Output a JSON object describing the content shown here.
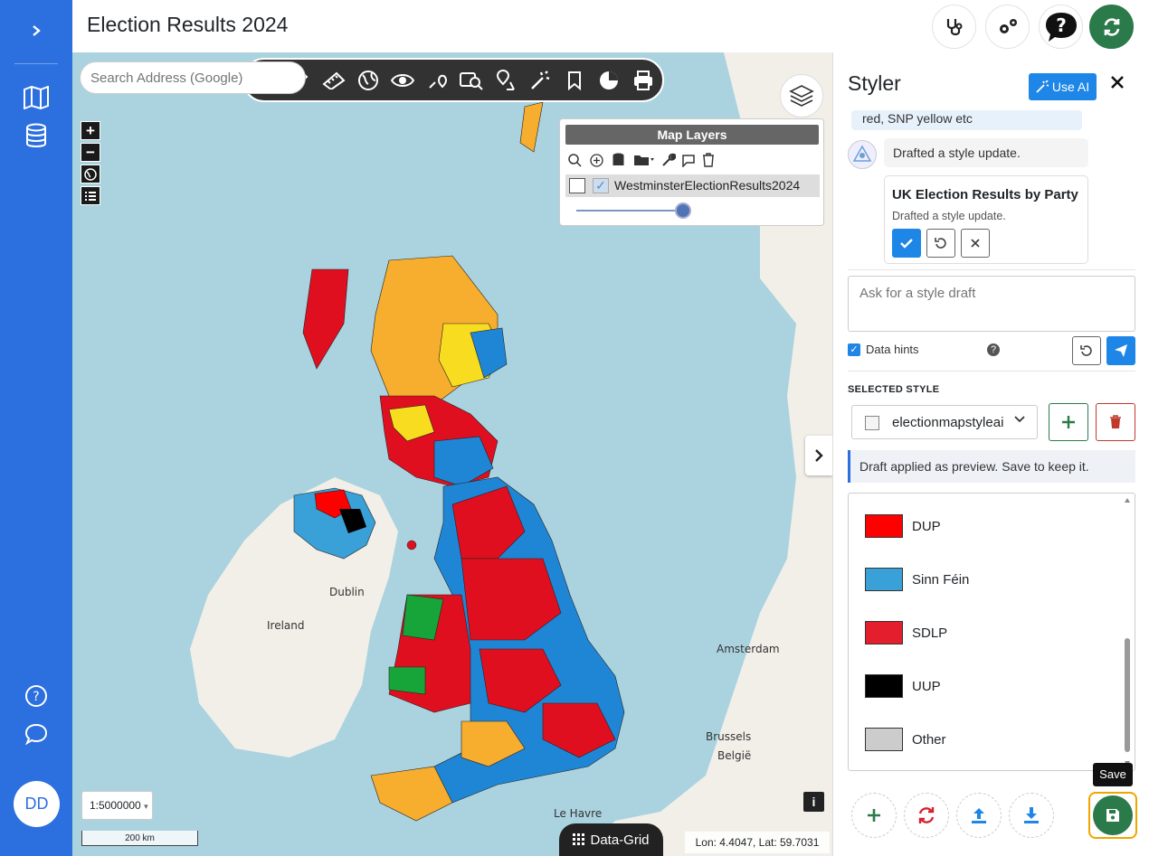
{
  "app": {
    "title": "Election Results 2024"
  },
  "leftbar": {
    "avatar_initials": "DD"
  },
  "map": {
    "search_placeholder": "Search Address (Google)",
    "layers_panel": {
      "title": "Map Layers",
      "layer_name": "WestminsterElectionResults2024"
    },
    "scale_select": "1:5000000",
    "scale_bar_label": "200 km",
    "data_grid_label": "Data-Grid",
    "coords": "Lon: 4.4047, Lat: 59.7031",
    "info_label": "i",
    "place_labels": {
      "dublin": "Dublin",
      "ireland": "Ireland",
      "amsterdam": "Amsterdam",
      "brussels": "Brussels",
      "belgium": "België",
      "le_havre": "Le Havre"
    }
  },
  "styler": {
    "title": "Styler",
    "use_ai_label": "Use AI",
    "chat": {
      "user_tail": "red, SNP yellow etc",
      "bot_message": "Drafted a style update.",
      "draft_title": "UK Election Results by Party",
      "draft_subtitle": "Drafted a style update."
    },
    "ask_placeholder": "Ask for a style draft",
    "data_hints_label": "Data hints",
    "selected_style_label": "SELECTED STYLE",
    "selected_style_value": "electionmapstyleai",
    "notice": "Draft applied as preview. Save to keep it.",
    "legend": [
      {
        "label": "DUP",
        "color": "#ff0000"
      },
      {
        "label": "Sinn Féin",
        "color": "#3aa0d8"
      },
      {
        "label": "SDLP",
        "color": "#e41e2c"
      },
      {
        "label": "UUP",
        "color": "#000000"
      },
      {
        "label": "Other",
        "color": "#cccccc"
      }
    ],
    "save_tooltip": "Save"
  },
  "colors": {
    "accent": "#2c6fde",
    "labour": "#e00f1f",
    "conservative": "#1f86d6",
    "libdem": "#f7ad2e",
    "snp": "#f7dc1f",
    "plaid": "#17a53a",
    "reform": "#26c4c8"
  }
}
